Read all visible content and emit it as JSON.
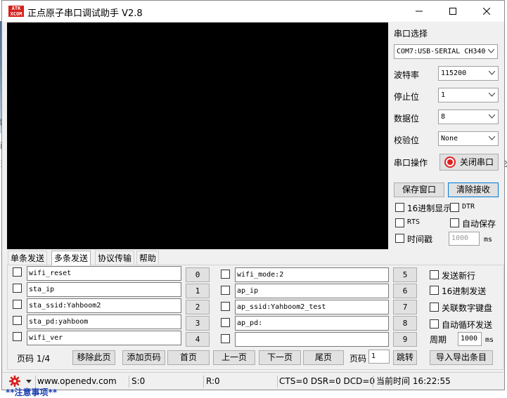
{
  "app": {
    "logo_text_1": "ATK",
    "logo_text_2": "XCOM",
    "title": "正点原子串口调试助手 V2.8"
  },
  "background": {
    "frag_1": "制",
    "frag_2": "酉",
    "frag_3": "当",
    "frag_4": "仑",
    "bottom_text": "**注意事项**"
  },
  "right_panel": {
    "port_select_label": "串口选择",
    "port_value": "COM7:USB-SERIAL CH340",
    "baud_label": "波特率",
    "baud_value": "115200",
    "stop_label": "停止位",
    "stop_value": "1",
    "data_label": "数据位",
    "data_value": "8",
    "parity_label": "校验位",
    "parity_value": "None",
    "op_label": "串口操作",
    "open_close_label": "关闭串口",
    "save_window_label": "保存窗口",
    "clear_receive_label": "清除接收",
    "hex_display_label": "16进制显示",
    "dtr_label": "DTR",
    "rts_label": "RTS",
    "auto_save_label": "自动保存",
    "timestamp_label": "时间戳",
    "timestamp_value": "1000",
    "ms_label": "ms"
  },
  "tabs": [
    {
      "label": "单条发送"
    },
    {
      "label": "多条发送"
    },
    {
      "label": "协议传输"
    },
    {
      "label": "帮助"
    }
  ],
  "multi_send": {
    "left_entries": [
      {
        "text": "wifi_reset",
        "num": "0"
      },
      {
        "text": "sta_ip",
        "num": "1"
      },
      {
        "text": "sta_ssid:Yahboom2",
        "num": "2"
      },
      {
        "text": "sta_pd:yahboom",
        "num": "3"
      },
      {
        "text": "wifi_ver",
        "num": "4"
      }
    ],
    "right_entries": [
      {
        "text": "wifi_mode:2",
        "num": "5"
      },
      {
        "text": "ap_ip",
        "num": "6"
      },
      {
        "text": "ap_ssid:Yahboom2_test",
        "num": "7"
      },
      {
        "text": "ap_pd:",
        "num": "8"
      },
      {
        "text": "",
        "num": "9"
      }
    ],
    "send_newline_label": "发送新行",
    "hex_send_label": "16进制发送",
    "link_keyboard_label": "关联数字键盘",
    "auto_loop_label": "自动循环发送",
    "period_label": "周期",
    "period_value": "1000",
    "ms_label": "ms",
    "page_info": "页码 1/4",
    "remove_page_label": "移除此页",
    "add_page_label": "添加页码",
    "first_page_label": "首页",
    "prev_page_label": "上一页",
    "next_page_label": "下一页",
    "last_page_label": "尾页",
    "page_label": "页码",
    "page_value": "1",
    "jump_label": "跳转",
    "import_export_label": "导入导出条目"
  },
  "statusbar": {
    "url": "www.openedv.com",
    "sent": "S:0",
    "received": "R:0",
    "signals": "CTS=0 DSR=0 DCD=0",
    "time": "当前时间 16:22:55"
  }
}
